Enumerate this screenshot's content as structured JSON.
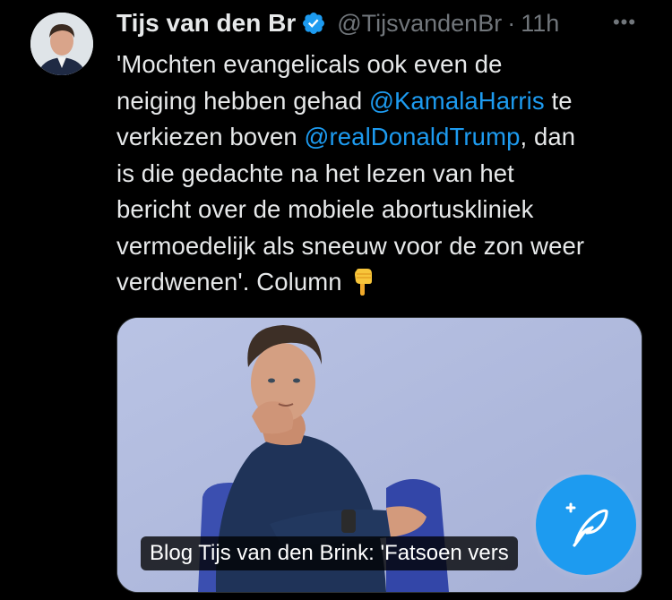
{
  "tweet": {
    "author": {
      "display_name": "Tijs van den Br",
      "handle": "@TijsvandenBr",
      "verified": true
    },
    "separator": "·",
    "timestamp": "11h",
    "more_label": "•••",
    "text": {
      "line1": "'Mochten evangelicals ook even de",
      "line2_a": "neiging hebben gehad ",
      "mention1": "@KamalaHarris",
      "line2_b": " te",
      "line3_a": "verkiezen boven ",
      "mention2": "@realDonaldTrump",
      "line3_b": ", dan",
      "line4": "is die gedachte na het lezen van het",
      "line5": "bericht over de mobiele abortuskliniek",
      "line6": "vermoedelijk als sneeuw voor de zon weer",
      "line7": "verdwenen'. Column"
    },
    "card": {
      "caption": "Blog Tijs van den Brink: 'Fatsoen vers"
    }
  },
  "colors": {
    "background": "#000000",
    "text": "#e7e9ea",
    "muted": "#71767b",
    "accent": "#1d9bf0"
  },
  "icons": [
    "verified-badge-icon",
    "more-icon",
    "pointing-down-emoji-icon",
    "compose-feather-icon"
  ]
}
